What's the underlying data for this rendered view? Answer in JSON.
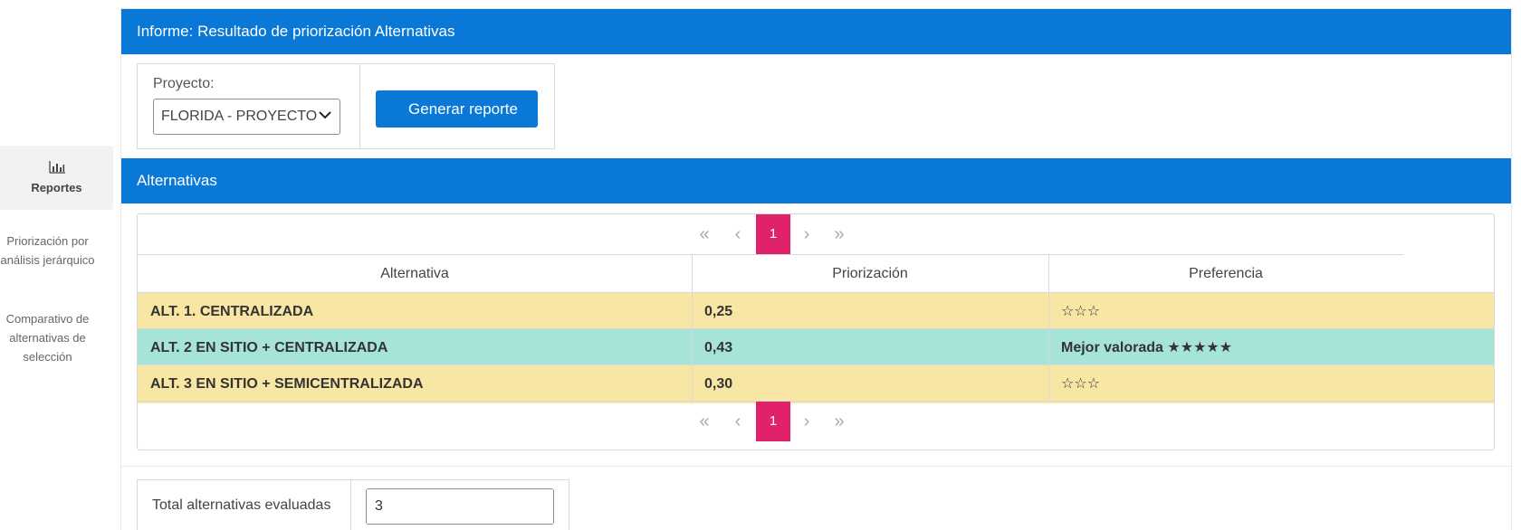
{
  "sidebar": {
    "active": {
      "icon": "bar-chart-icon",
      "label": "Reportes"
    },
    "links": [
      {
        "label": "Priorización por análisis jerárquico"
      },
      {
        "label": "Comparativo de alternativas de selección"
      }
    ]
  },
  "report": {
    "title": "Informe: Resultado de priorización Alternativas",
    "project_label": "Proyecto:",
    "project_value": "FLORIDA - PROYECTO",
    "generate_button": "Generar reporte"
  },
  "alternatives": {
    "title": "Alternativas",
    "pager": {
      "first": "«",
      "prev": "‹",
      "current": "1",
      "next": "›",
      "last": "»"
    },
    "columns": [
      "Alternativa",
      "Priorización",
      "Preferencia"
    ],
    "rows": [
      {
        "name": "ALT. 1. CENTRALIZADA",
        "score": "0,25",
        "preference": "☆☆☆",
        "color": "#f8e6a4"
      },
      {
        "name": "ALT. 2 EN SITIO + CENTRALIZADA",
        "score": "0,43",
        "preference": "Mejor valorada ★★★★★",
        "color": "#a6e4d7"
      },
      {
        "name": "ALT. 3 EN SITIO + SEMICENTRALIZADA",
        "score": "0,30",
        "preference": "☆☆☆",
        "color": "#f8e6a4"
      }
    ]
  },
  "summary": {
    "label": "Total alternativas evaluadas",
    "value": "3"
  },
  "colors": {
    "primary": "#0a78d7",
    "pager_active": "#e0226b"
  }
}
